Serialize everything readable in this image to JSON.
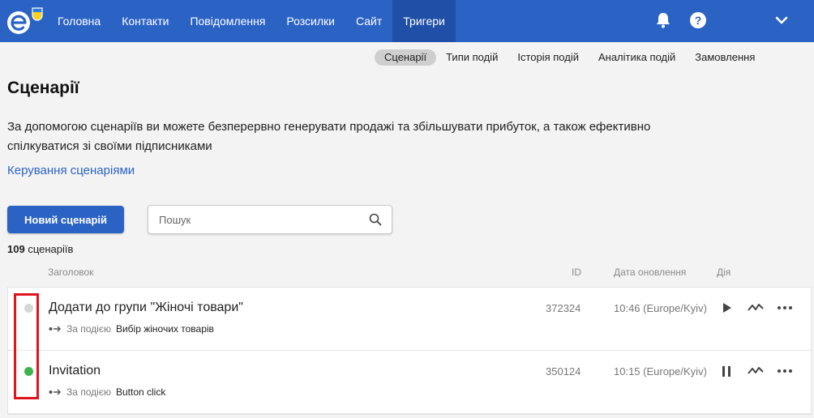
{
  "nav": {
    "items": [
      {
        "label": "Головна",
        "active": false
      },
      {
        "label": "Контакти",
        "active": false
      },
      {
        "label": "Повідомлення",
        "active": false
      },
      {
        "label": "Розсилки",
        "active": false
      },
      {
        "label": "Сайт",
        "active": false
      },
      {
        "label": "Тригери",
        "active": true
      }
    ],
    "icons": [
      "logo-icon",
      "bell-icon",
      "help-icon",
      "chevron-down-icon"
    ],
    "colors": {
      "bar": "#2b63c5",
      "active": "#1f4fa6"
    }
  },
  "subtabs": [
    {
      "label": "Сценарії",
      "active": true
    },
    {
      "label": "Типи подій",
      "active": false
    },
    {
      "label": "Історія подій",
      "active": false
    },
    {
      "label": "Аналітика подій",
      "active": false
    },
    {
      "label": "Замовлення",
      "active": false
    }
  ],
  "page": {
    "title": "Сценарії",
    "description": "За допомогою сценаріїв ви можете безперервно генерувати продажі та збільшувати прибуток, а також ефективно спілкуватися зі своїми підписниками",
    "manage_link": "Керування сценаріями",
    "new_button": "Новий сценарій",
    "search_placeholder": "Пошук",
    "search_value": "",
    "count_number": "109",
    "count_label": "сценаріїв"
  },
  "table": {
    "headers": {
      "title": "Заголовок",
      "id": "ID",
      "updated": "Дата оновлення",
      "action": "Дія"
    },
    "rows": [
      {
        "status": "inactive",
        "status_color": "#d6d6d6",
        "title": "Додати до групи \"Жіночі товари\"",
        "trigger_prefix": "За подією",
        "trigger_event": "Вибір жіночих товарів",
        "id": "372324",
        "updated": "10:46 (Europe/Kyiv)",
        "actions": [
          "play-icon",
          "analytics-icon",
          "more-icon"
        ]
      },
      {
        "status": "active",
        "status_color": "#3bb54a",
        "title": "Invitation",
        "trigger_prefix": "За подією",
        "trigger_event": "Button click",
        "id": "350124",
        "updated": "10:15 (Europe/Kyiv)",
        "actions": [
          "pause-icon",
          "analytics-icon",
          "more-icon"
        ]
      }
    ]
  },
  "highlight_color": "#e0141e"
}
